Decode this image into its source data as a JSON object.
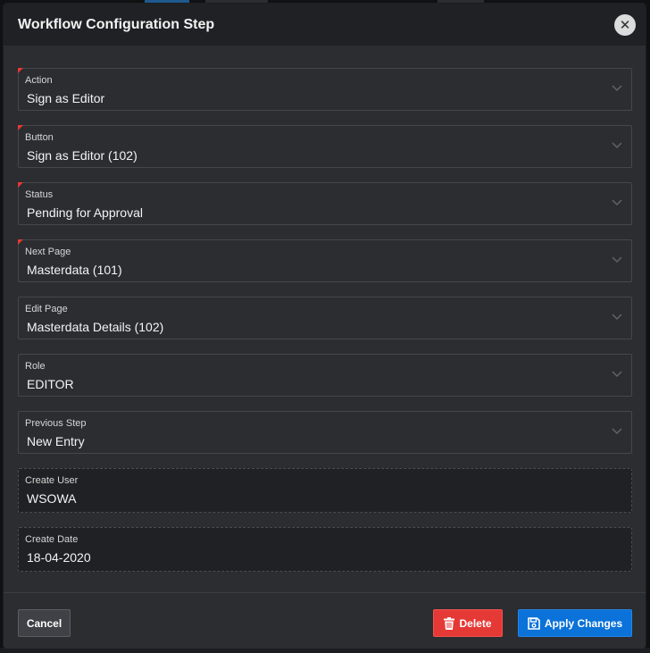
{
  "dialog": {
    "title": "Workflow Configuration Step",
    "close_icon": "close-icon"
  },
  "fields": {
    "action": {
      "label": "Action",
      "value": "Sign as Editor",
      "required": true,
      "type": "select"
    },
    "button": {
      "label": "Button",
      "value": "Sign as Editor (102)",
      "required": true,
      "type": "select"
    },
    "status": {
      "label": "Status",
      "value": "Pending for Approval",
      "required": true,
      "type": "select"
    },
    "next_page": {
      "label": "Next Page",
      "value": "Masterdata (101)",
      "required": true,
      "type": "select"
    },
    "edit_page": {
      "label": "Edit Page",
      "value": "Masterdata Details (102)",
      "required": false,
      "type": "select"
    },
    "role": {
      "label": "Role",
      "value": "EDITOR",
      "required": false,
      "type": "select"
    },
    "previous_step": {
      "label": "Previous Step",
      "value": "New Entry",
      "required": false,
      "type": "select"
    },
    "create_user": {
      "label": "Create User",
      "value": "WSOWA",
      "required": false,
      "type": "readonly"
    },
    "create_date": {
      "label": "Create Date",
      "value": "18-04-2020",
      "required": false,
      "type": "readonly"
    }
  },
  "footer": {
    "cancel_label": "Cancel",
    "delete_label": "Delete",
    "delete_icon": "trash-icon",
    "apply_label": "Apply Changes",
    "apply_icon": "save-icon"
  },
  "colors": {
    "dialog_bg": "#2b2d31",
    "header_bg": "#1f2124",
    "required_marker": "#e53935",
    "delete_bg": "#e53935",
    "apply_bg": "#0a72d8"
  }
}
